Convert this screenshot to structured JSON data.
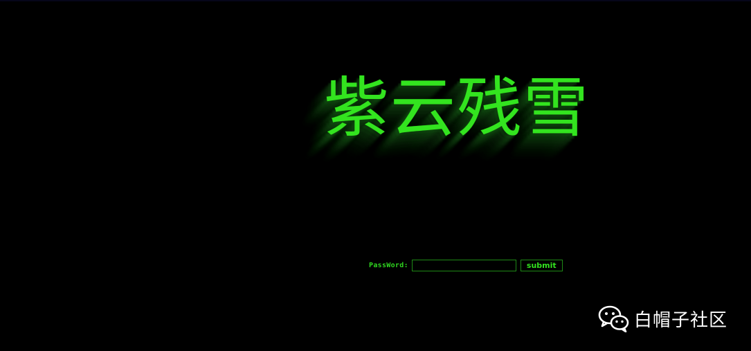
{
  "page": {
    "background": "#000000"
  },
  "banner": {
    "title": "紫云残雪",
    "color": "#33e41f"
  },
  "login": {
    "password_label": "PassWord:",
    "password_value": "",
    "submit_label": "submit",
    "accent": "#1e8a16"
  },
  "watermark": {
    "icon": "wechat-icon",
    "text": "白帽子社区",
    "color": "#ffffff"
  }
}
